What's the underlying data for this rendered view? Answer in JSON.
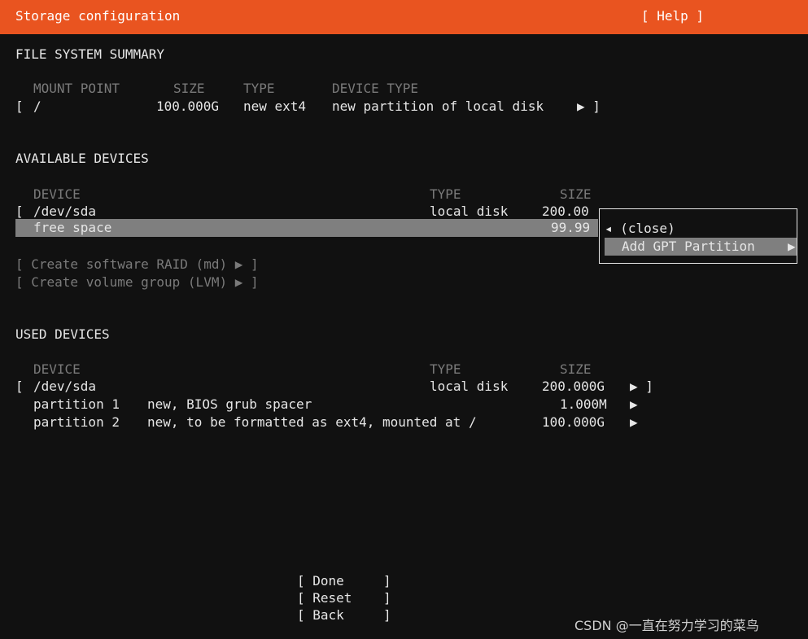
{
  "header": {
    "title": "Storage configuration",
    "help": "[ Help ]",
    "bg_color": "#e95420"
  },
  "fs_summary": {
    "heading": "FILE SYSTEM SUMMARY",
    "columns": [
      "MOUNT POINT",
      "SIZE",
      "TYPE",
      "DEVICE TYPE"
    ],
    "row": {
      "open": "[",
      "mount": "/",
      "size": "100.000G",
      "type": "new ext4",
      "device_type": "new partition of local disk",
      "arrow": "▶ ]"
    }
  },
  "available": {
    "heading": "AVAILABLE DEVICES",
    "columns": [
      "DEVICE",
      "TYPE",
      "SIZE"
    ],
    "device": {
      "open": "[",
      "name": "/dev/sda",
      "type": "local disk",
      "size": "200.00"
    },
    "free": {
      "name": "free space",
      "size": "99.99"
    },
    "raid": "[ Create software RAID (md) ▶ ]",
    "lvm": "[ Create volume group (LVM) ▶ ]"
  },
  "menu": {
    "close": "◂ (close)",
    "add_gpt": "Add GPT Partition",
    "add_gpt_arrow": "▶"
  },
  "used": {
    "heading": "USED DEVICES",
    "columns": [
      "DEVICE",
      "TYPE",
      "SIZE"
    ],
    "device": {
      "open": "[",
      "name": "/dev/sda",
      "type": "local disk",
      "size": "200.000G",
      "arrow": "▶ ]"
    },
    "partitions": [
      {
        "name": "partition 1",
        "desc": "new, BIOS grub spacer",
        "size": "1.000M",
        "arrow": "▶"
      },
      {
        "name": "partition 2",
        "desc": "new, to be formatted as ext4, mounted at /",
        "size": "100.000G",
        "arrow": "▶"
      }
    ]
  },
  "buttons": {
    "done": "[ Done     ]",
    "reset": "[ Reset    ]",
    "back": "[ Back     ]"
  },
  "watermark": "CSDN @一直在努力学习的菜鸟"
}
